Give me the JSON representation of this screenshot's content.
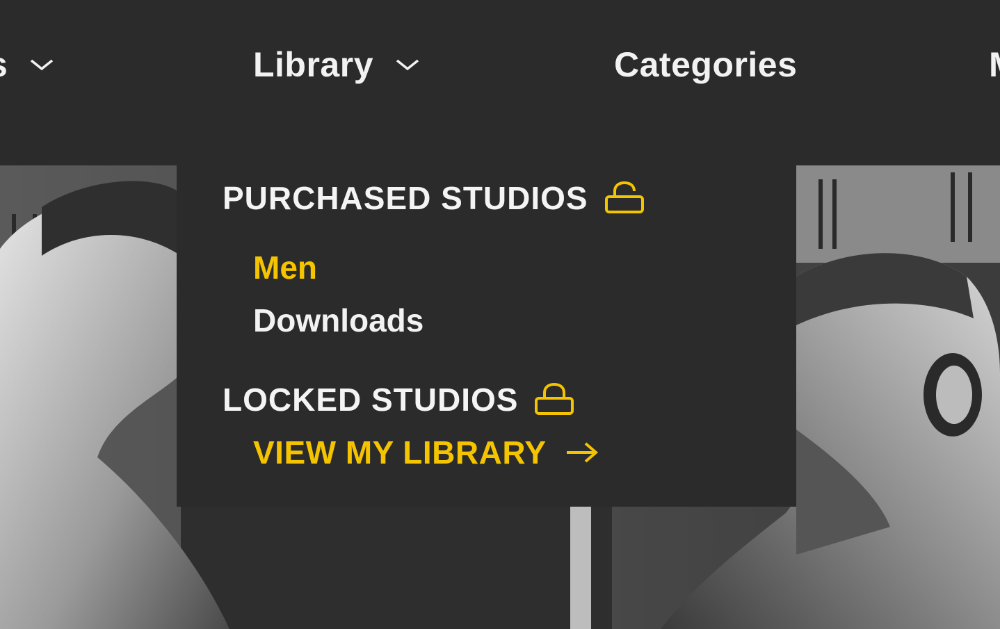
{
  "nav": {
    "items": [
      {
        "label": "os",
        "has_chevron": true
      },
      {
        "label": "Library",
        "has_chevron": true
      },
      {
        "label": "Categories",
        "has_chevron": false
      },
      {
        "label": "M",
        "has_chevron": false
      }
    ]
  },
  "dropdown": {
    "purchased_heading": "PURCHASED STUDIOS",
    "purchased_icon": "unlock-icon",
    "purchased_links": [
      {
        "label": "Men",
        "active": true
      },
      {
        "label": "Downloads",
        "active": false
      }
    ],
    "locked_heading": "LOCKED STUDIOS",
    "locked_icon": "lock-icon",
    "cta_label": "VIEW MY LIBRARY",
    "cta_icon": "arrow-right-icon"
  },
  "colors": {
    "background": "#2b2b2b",
    "text": "#f2f2f2",
    "accent": "#f5c400"
  }
}
